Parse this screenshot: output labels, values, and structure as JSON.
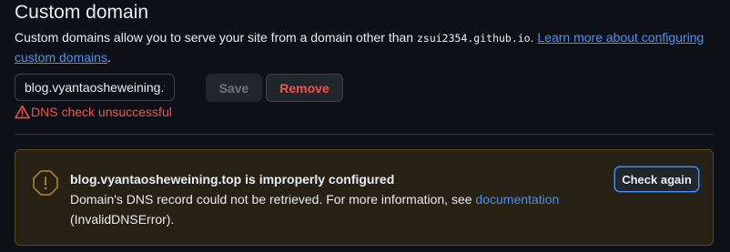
{
  "section": {
    "title": "Custom domain",
    "description_prefix": "Custom domains allow you to serve your site from a domain other than ",
    "default_domain": "zsui2354.github.io",
    "description_suffix": ".",
    "learn_more_link": "Learn more about configuring custom domains"
  },
  "form": {
    "domain_value": "blog.vyantaosheweining.top",
    "save_label": "Save",
    "remove_label": "Remove"
  },
  "dns_status": {
    "message": "DNS check unsuccessful",
    "icon": "alert-triangle-icon"
  },
  "warning": {
    "icon": "alert-octagon-icon",
    "title": "blog.vyantaosheweining.top is improperly configured",
    "message_prefix": "Domain's DNS record could not be retrieved. For more information, see ",
    "doc_link": "documentation",
    "message_suffix": "(InvalidDNSError).",
    "check_again_label": "Check again"
  },
  "colors": {
    "background": "#0d1117",
    "error": "#f85149",
    "link": "#4493f8",
    "warning_bg": "#272115",
    "warning_border": "#5c4a1c",
    "warning_icon": "#a37b28"
  }
}
